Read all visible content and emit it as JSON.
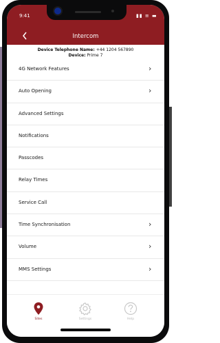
{
  "status_bar": {
    "time": "9:41",
    "icons": "▮▮ ≡ ▬"
  },
  "nav": {
    "back_icon": "chevron-left-icon",
    "title": "Intercom"
  },
  "device_info": {
    "telephone_label": "Device Telephone Name:",
    "telephone_value": "+44 1204 567890",
    "device_label": "Device:",
    "device_value": "Prime 7"
  },
  "menu": {
    "items": [
      {
        "label": "4G Network Features",
        "chevron": "›"
      },
      {
        "label": "Auto Opening",
        "chevron": "›"
      },
      {
        "label": "Advanced Settings",
        "chevron": ""
      },
      {
        "label": "Notifications",
        "chevron": ""
      },
      {
        "label": "Passcodes",
        "chevron": ""
      },
      {
        "label": "Relay Times",
        "chevron": ""
      },
      {
        "label": "Service Call",
        "chevron": ""
      },
      {
        "label": "Time Synchronisation",
        "chevron": "›"
      },
      {
        "label": "Volume",
        "chevron": "›"
      },
      {
        "label": "MMS Settings",
        "chevron": "›"
      }
    ]
  },
  "tabs": [
    {
      "label": "Sites",
      "icon": "location-pin-icon",
      "active": true
    },
    {
      "label": "Settings",
      "icon": "gear-icon",
      "active": false
    },
    {
      "label": "Help",
      "icon": "question-circle-icon",
      "active": false
    }
  ],
  "colors": {
    "brand": "#8e1d22",
    "background_panel": "#8e7d99",
    "side_card": "#414141"
  }
}
